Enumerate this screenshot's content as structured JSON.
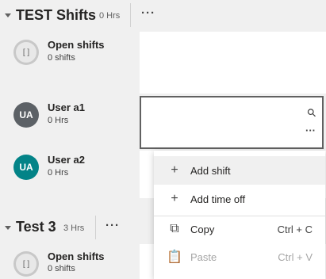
{
  "groups": [
    {
      "title": "TEST Shifts",
      "hours": "0 Hrs"
    },
    {
      "title": "Test 3",
      "hours": "3 Hrs"
    }
  ],
  "more_label": "···",
  "rows": [
    {
      "name": "Open shifts",
      "sub": "0 shifts",
      "avatar": ""
    },
    {
      "name": "User a1",
      "sub": "0 Hrs",
      "avatar": "UA"
    },
    {
      "name": "User a2",
      "sub": "0 Hrs",
      "avatar": "UA"
    },
    {
      "name": "Open shifts",
      "sub": "0 shifts",
      "avatar": ""
    }
  ],
  "cell": {
    "search_glyph": "⚲",
    "more_glyph": "···"
  },
  "menu": {
    "items": [
      {
        "icon": "plus-icon",
        "glyph": "+",
        "label": "Add shift",
        "shortcut": ""
      },
      {
        "icon": "plus-icon",
        "glyph": "+",
        "label": "Add time off",
        "shortcut": ""
      },
      {
        "icon": "copy-icon",
        "glyph": "⧉",
        "label": "Copy",
        "shortcut": "Ctrl + C"
      },
      {
        "icon": "paste-icon",
        "glyph": "📋",
        "label": "Paste",
        "shortcut": "Ctrl + V"
      }
    ]
  },
  "colors": {
    "avatar_teal": "#038387",
    "avatar_gray": "#5c6166",
    "accent": "#616161"
  }
}
